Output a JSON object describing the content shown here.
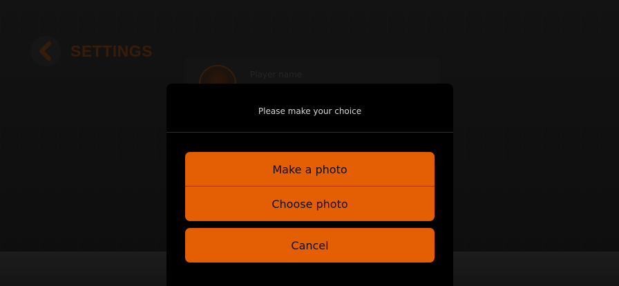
{
  "header": {
    "title": "SETTINGS"
  },
  "profile": {
    "player_name_placeholder": "Player name"
  },
  "dialog": {
    "title": "Please make your choice",
    "options": [
      {
        "label": "Make a photo"
      },
      {
        "label": "Choose photo"
      }
    ],
    "cancel_label": "Cancel"
  },
  "colors": {
    "accent": "#e45f04",
    "dialog_background": "#000000",
    "title_dimmed": "#6e3812"
  },
  "icons": {
    "back": "chevron-left-icon",
    "avatar": "avatar-image"
  }
}
